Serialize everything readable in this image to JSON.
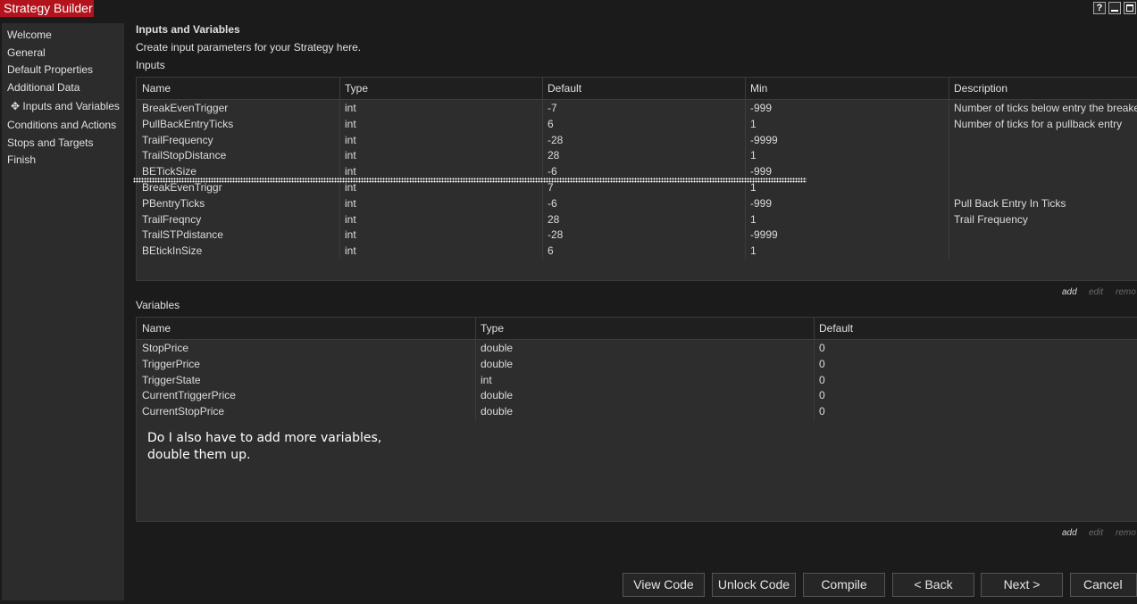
{
  "window": {
    "title": "Strategy Builder",
    "help_glyph": "?",
    "minimize_glyph": "—",
    "maximize_glyph": "□"
  },
  "sidebar": {
    "items": [
      {
        "label": "Welcome"
      },
      {
        "label": "General"
      },
      {
        "label": "Default Properties"
      },
      {
        "label": "Additional Data"
      },
      {
        "label": "✥ Inputs and Variables",
        "active": true
      },
      {
        "label": "Conditions and Actions"
      },
      {
        "label": "Stops and Targets"
      },
      {
        "label": "Finish"
      }
    ]
  },
  "page": {
    "title": "Inputs and Variables",
    "description": "Create input parameters for your Strategy here.",
    "inputs_label": "Inputs",
    "variables_label": "Variables"
  },
  "inputs_table": {
    "headers": [
      "Name",
      "Type",
      "Default",
      "Min",
      "Description"
    ],
    "rows": [
      [
        "BreakEvenTrigger",
        "int",
        "-7",
        "-999",
        "Number of ticks below entry the breakeven"
      ],
      [
        "PullBackEntryTicks",
        "int",
        "6",
        "1",
        "Number of ticks for a pullback entry"
      ],
      [
        "TrailFrequency",
        "int",
        "-28",
        "-9999",
        ""
      ],
      [
        "TrailStopDistance",
        "int",
        "28",
        "1",
        ""
      ],
      [
        "BETickSize",
        "int",
        "-6",
        "-999",
        ""
      ],
      [
        "BreakEvenTriggr",
        "int",
        "7",
        "1",
        ""
      ],
      [
        "PBentryTicks",
        "int",
        "-6",
        "-999",
        "Pull Back Entry In Ticks"
      ],
      [
        "TrailFreqncy",
        "int",
        "28",
        "1",
        "Trail Frequency"
      ],
      [
        "TrailSTPdistance",
        "int",
        "-28",
        "-9999",
        ""
      ],
      [
        "BEtickInSize",
        "int",
        "6",
        "1",
        ""
      ]
    ]
  },
  "variables_table": {
    "headers": [
      "Name",
      "Type",
      "Default"
    ],
    "rows": [
      [
        "StopPrice",
        "double",
        "0"
      ],
      [
        "TriggerPrice",
        "double",
        "0"
      ],
      [
        "TriggerState",
        "int",
        "0"
      ],
      [
        "CurrentTriggerPrice",
        "double",
        "0"
      ],
      [
        "CurrentStopPrice",
        "double",
        "0"
      ]
    ]
  },
  "table_actions": {
    "add": "add",
    "edit": "edit",
    "remove": "remo"
  },
  "annotation": {
    "line1": "Do I also have to add more variables,",
    "line2": "double them up."
  },
  "buttons": {
    "view_code": "View Code",
    "unlock_code": "Unlock Code",
    "compile": "Compile",
    "back": "< Back",
    "next": "Next >",
    "cancel": "Cancel"
  },
  "colors": {
    "title_accent": "#b3131c",
    "background": "#1b1b1b",
    "panel": "#2d2d2d",
    "header": "#1f1f1f"
  }
}
